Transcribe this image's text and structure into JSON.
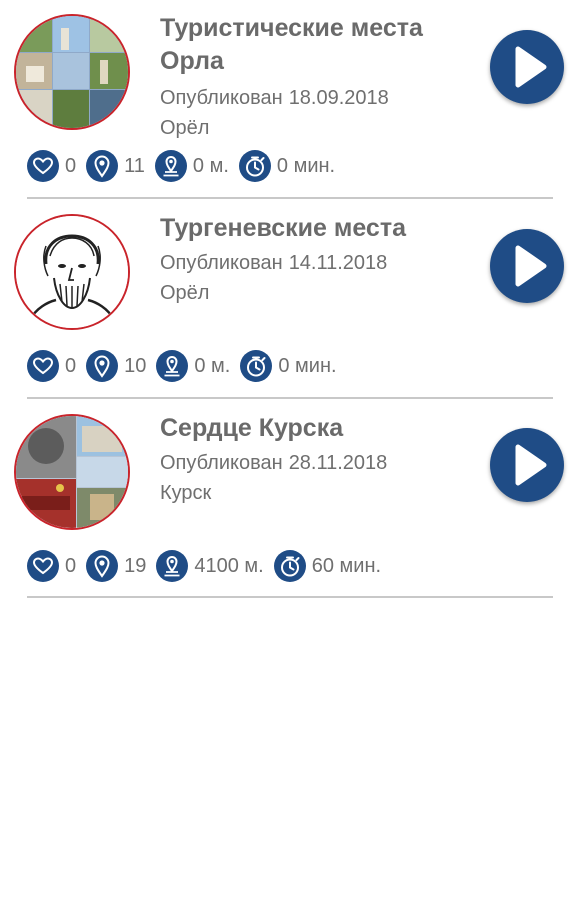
{
  "accent_color": "#1f4c86",
  "thumb_border_color": "#c9242b",
  "tours": [
    {
      "title": "Туристические места Орла",
      "published_prefix": "Опубликован",
      "published_date": "18.09.2018",
      "city": "Орёл",
      "likes": "0",
      "points": "11",
      "distance": "0 м.",
      "duration": "0 мин.",
      "thumbnail_icon": "photo-collage-icon",
      "play_icon": "play-icon"
    },
    {
      "title": "Тургеневские места",
      "published_prefix": "Опубликован",
      "published_date": "14.11.2018",
      "city": "Орёл",
      "likes": "0",
      "points": "10",
      "distance": "0 м.",
      "duration": "0 мин.",
      "thumbnail_icon": "portrait-sketch-icon",
      "play_icon": "play-icon"
    },
    {
      "title": "Сердце Курска",
      "published_prefix": "Опубликован",
      "published_date": "28.11.2018",
      "city": "Курск",
      "likes": "0",
      "points": "19",
      "distance": "4100 м.",
      "duration": "60 мин.",
      "thumbnail_icon": "photo-collage-icon",
      "play_icon": "play-icon"
    }
  ]
}
